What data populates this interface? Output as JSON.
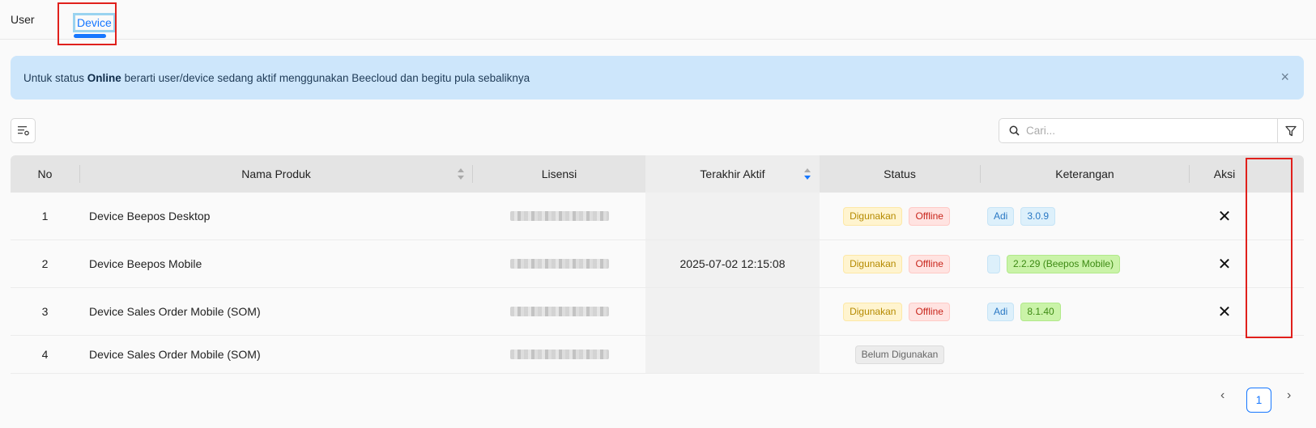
{
  "tabs": [
    {
      "label": "User"
    },
    {
      "label": "Device"
    }
  ],
  "alert": {
    "prefix": "Untuk status ",
    "bold": "Online",
    "suffix": " berarti user/device sedang aktif menggunakan Beecloud dan begitu pula sebaliknya",
    "close_icon": "×"
  },
  "search": {
    "placeholder": "Cari...",
    "value": ""
  },
  "table": {
    "columns": [
      "No",
      "Nama Produk",
      "Lisensi",
      "Terakhir Aktif",
      "Status",
      "Keterangan",
      "Aksi"
    ],
    "rows": [
      {
        "no": "1",
        "produk": "Device Beepos Desktop",
        "aktif": "",
        "status": [
          "Digunakan",
          "Offline"
        ],
        "ket_user": "Adi",
        "ket_version": "3.0.9",
        "aksi": "✕"
      },
      {
        "no": "2",
        "produk": "Device Beepos Mobile",
        "aktif": "2025-07-02 12:15:08",
        "status": [
          "Digunakan",
          "Offline"
        ],
        "ket_user": "",
        "ket_version": "2.2.29 (Beepos Mobile)",
        "aksi": "✕"
      },
      {
        "no": "3",
        "produk": "Device Sales Order Mobile (SOM)",
        "aktif": "",
        "status": [
          "Digunakan",
          "Offline"
        ],
        "ket_user": "Adi",
        "ket_version": "8.1.40",
        "aksi": "✕"
      },
      {
        "no": "4",
        "produk": "Device Sales Order Mobile (SOM)",
        "aktif": "",
        "status": [
          "Belum Digunakan"
        ]
      }
    ]
  },
  "pagination": {
    "current": "1",
    "prev": "‹",
    "next": "›"
  },
  "colors": {
    "accent": "#1677ff",
    "alert_bg": "#cde6fb",
    "highlight": "#e0201c"
  }
}
